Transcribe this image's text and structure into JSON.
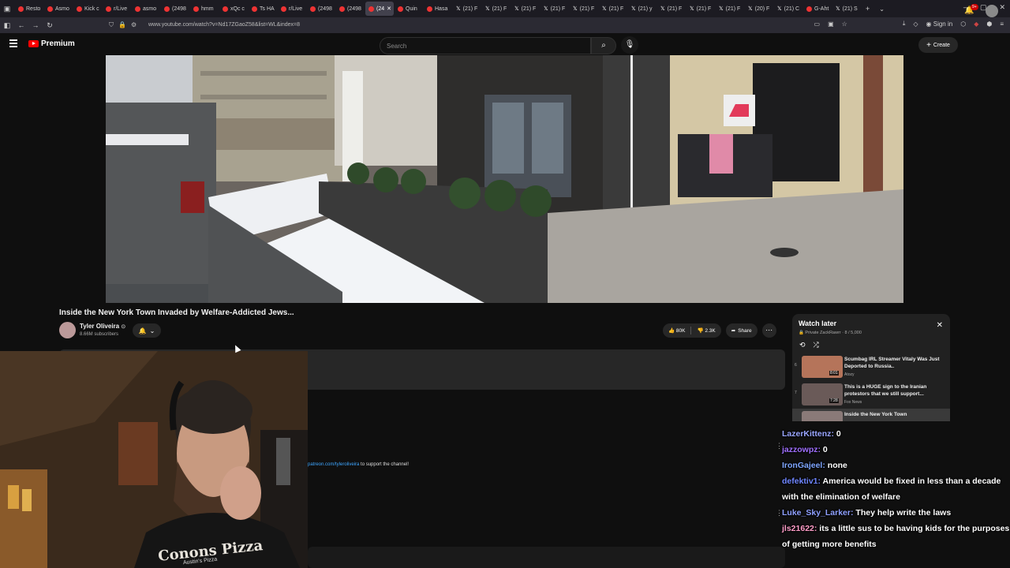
{
  "browser": {
    "tabs": [
      {
        "label": "Resto",
        "active": false
      },
      {
        "label": "Asmo",
        "active": false
      },
      {
        "label": "Kick c",
        "active": false
      },
      {
        "label": "r/Live",
        "active": false
      },
      {
        "label": "asmo",
        "active": false
      },
      {
        "label": "(2498",
        "active": false
      },
      {
        "label": "hmm",
        "active": false
      },
      {
        "label": "xQc c",
        "active": false
      },
      {
        "label": "Ts HA",
        "active": false
      },
      {
        "label": "r/Live",
        "active": false
      },
      {
        "label": "(2498",
        "active": false
      },
      {
        "label": "(2498",
        "active": false
      },
      {
        "label": "(24",
        "active": true
      },
      {
        "label": "Quin",
        "active": false
      },
      {
        "label": "Hasa",
        "active": false
      },
      {
        "label": "(21) F",
        "active": false
      },
      {
        "label": "(21) F",
        "active": false
      },
      {
        "label": "(21) F",
        "active": false
      },
      {
        "label": "(21) F",
        "active": false
      },
      {
        "label": "(21) F",
        "active": false
      },
      {
        "label": "(21) F",
        "active": false
      },
      {
        "label": "(21) y",
        "active": false
      },
      {
        "label": "(21) F",
        "active": false
      },
      {
        "label": "(21) F",
        "active": false
      },
      {
        "label": "(21) F",
        "active": false
      },
      {
        "label": "(20) F",
        "active": false
      },
      {
        "label": "(21) C",
        "active": false
      },
      {
        "label": "G-Aht",
        "active": false
      },
      {
        "label": "(21) S",
        "active": false
      }
    ],
    "url": "www.youtube.com/watch?v=Nd17ZGaoZ58&list=WL&index=8",
    "sign_in": "Sign in"
  },
  "youtube": {
    "logo_text": "Premium",
    "search_placeholder": "Search",
    "create_label": "Create",
    "notif_badge": "9+"
  },
  "video": {
    "title": "Inside the New York Town Invaded by Welfare-Addicted Jews...",
    "channel_name": "Tyler Oliveira",
    "verified": "⊙",
    "subscribers": "8.66M subscribers",
    "likes": "80K",
    "dislikes": "2.3K",
    "share": "Share",
    "desc_link": "patreon.com/tyleroliveira",
    "desc_text": " to support the channel!"
  },
  "watch_later": {
    "title": "Watch later",
    "subtitle": "Private ZackRawrr · 8 / 5,000",
    "items": [
      {
        "index": "6",
        "title": "Scumbag IRL Streamer Vitaly Was Just Deported to Russia..",
        "channel": "Atozy",
        "duration": "8:01"
      },
      {
        "index": "7",
        "title": "This is a HUGE sign to the Iranian protestors that we still support...",
        "channel": "Fox News",
        "duration": "7:28"
      },
      {
        "index": "",
        "title": "Inside the New York Town",
        "channel": "",
        "duration": ""
      }
    ]
  },
  "chat": {
    "messages": [
      {
        "user": "LazerKittenz",
        "color": "#9aa6ff",
        "text": " 0"
      },
      {
        "user": "jazzowpz",
        "color": "#a070ff",
        "text": " 0"
      },
      {
        "user": "IronGajeel",
        "color": "#7fa6ff",
        "text": " none"
      },
      {
        "user": "defektiv1",
        "color": "#6f86ff",
        "text": " America would be fixed in less than a decade with the elimination of welfare"
      },
      {
        "user": "Luke_Sky_Larker",
        "color": "#8fa0ff",
        "text": " They help write the laws"
      },
      {
        "user": "jls21622",
        "color": "#ff9dc8",
        "text": " its a little sus to be having kids for the purposes of getting more benefits"
      }
    ]
  },
  "webcam": {
    "shirt_text": "Conons Pizza",
    "shirt_sub": "Austin's Pizza"
  }
}
